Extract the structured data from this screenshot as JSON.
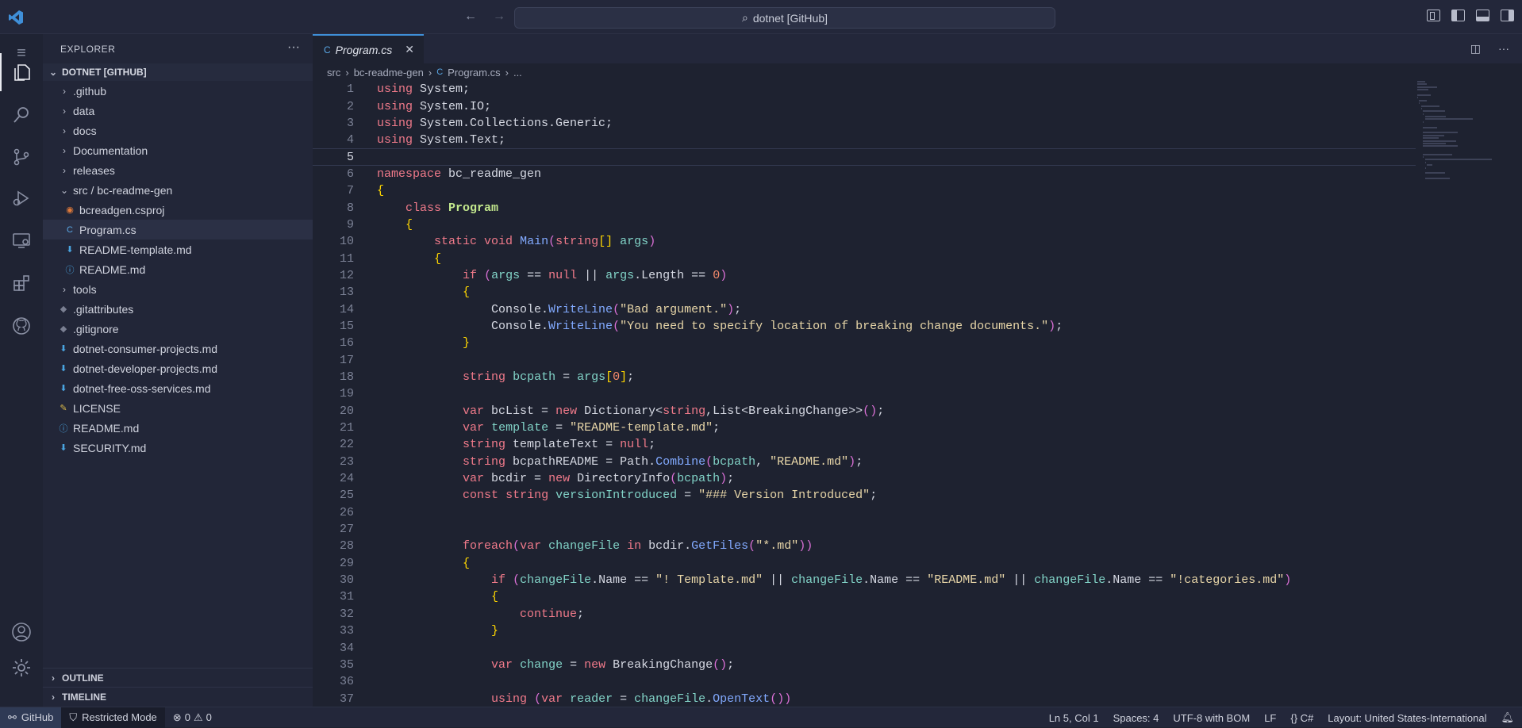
{
  "titlebar": {
    "command_center": "dotnet [GitHub]",
    "back_icon": "arrow-left-icon",
    "forward_icon": "arrow-right-icon"
  },
  "activity_bar": {
    "items": [
      "menu-icon",
      "explorer-icon",
      "search-icon",
      "source-control-icon",
      "run-debug-icon",
      "remote-explorer-icon",
      "extensions-icon",
      "github-icon",
      "accounts-icon",
      "manage-gear-icon"
    ]
  },
  "sidebar": {
    "title": "EXPLORER",
    "more": "···",
    "folder": "DOTNET [GITHUB]",
    "items": [
      {
        "label": ".github",
        "type": "folder"
      },
      {
        "label": "data",
        "type": "folder"
      },
      {
        "label": "docs",
        "type": "folder"
      },
      {
        "label": "Documentation",
        "type": "folder"
      },
      {
        "label": "releases",
        "type": "folder"
      },
      {
        "label": "src / bc-readme-gen",
        "type": "folder-open"
      },
      {
        "label": "bcreadgen.csproj",
        "type": "csproj"
      },
      {
        "label": "Program.cs",
        "type": "cs"
      },
      {
        "label": "README-template.md",
        "type": "md"
      },
      {
        "label": "README.md",
        "type": "info"
      },
      {
        "label": "tools",
        "type": "folder"
      },
      {
        "label": ".gitattributes",
        "type": "git"
      },
      {
        "label": ".gitignore",
        "type": "git"
      },
      {
        "label": "dotnet-consumer-projects.md",
        "type": "md"
      },
      {
        "label": "dotnet-developer-projects.md",
        "type": "md"
      },
      {
        "label": "dotnet-free-oss-services.md",
        "type": "md"
      },
      {
        "label": "LICENSE",
        "type": "license"
      },
      {
        "label": "README.md",
        "type": "info"
      },
      {
        "label": "SECURITY.md",
        "type": "md"
      }
    ],
    "outline": "OUTLINE",
    "timeline": "TIMELINE"
  },
  "editor": {
    "tab_label": "Program.cs",
    "breadcrumb": [
      "src",
      "bc-readme-gen",
      "Program.cs",
      "..."
    ],
    "current_line": 5,
    "lines": [
      "using System;",
      "using System.IO;",
      "using System.Collections.Generic;",
      "using System.Text;",
      "",
      "namespace bc_readme_gen",
      "{",
      "    class Program",
      "    {",
      "        static void Main(string[] args)",
      "        {",
      "            if (args == null || args.Length == 0)",
      "            {",
      "                Console.WriteLine(\"Bad argument.\");",
      "                Console.WriteLine(\"You need to specify location of breaking change documents.\");",
      "            }",
      "",
      "            string bcpath = args[0];",
      "",
      "            var bcList = new Dictionary<string,List<BreakingChange>>();",
      "            var template = \"README-template.md\";",
      "            string templateText = null;",
      "            string bcpathREADME = Path.Combine(bcpath, \"README.md\");",
      "            var bcdir = new DirectoryInfo(bcpath);",
      "            const string versionIntroduced = \"### Version Introduced\";",
      "",
      "",
      "            foreach(var changeFile in bcdir.GetFiles(\"*.md\"))",
      "            {",
      "                if (changeFile.Name == \"! Template.md\" || changeFile.Name == \"README.md\" || changeFile.Name == \"!categories.md\")",
      "                {",
      "                    continue;",
      "                }",
      "",
      "                var change = new BreakingChange();",
      "",
      "                using (var reader = changeFile.OpenText())"
    ]
  },
  "statusbar": {
    "remote": "GitHub",
    "restricted": "Restricted Mode",
    "errors": "0",
    "warnings": "0",
    "position": "Ln 5, Col 1",
    "spaces": "Spaces: 4",
    "encoding": "UTF-8 with BOM",
    "eol": "LF",
    "language": "C#",
    "layout": "Layout: United States-International"
  }
}
